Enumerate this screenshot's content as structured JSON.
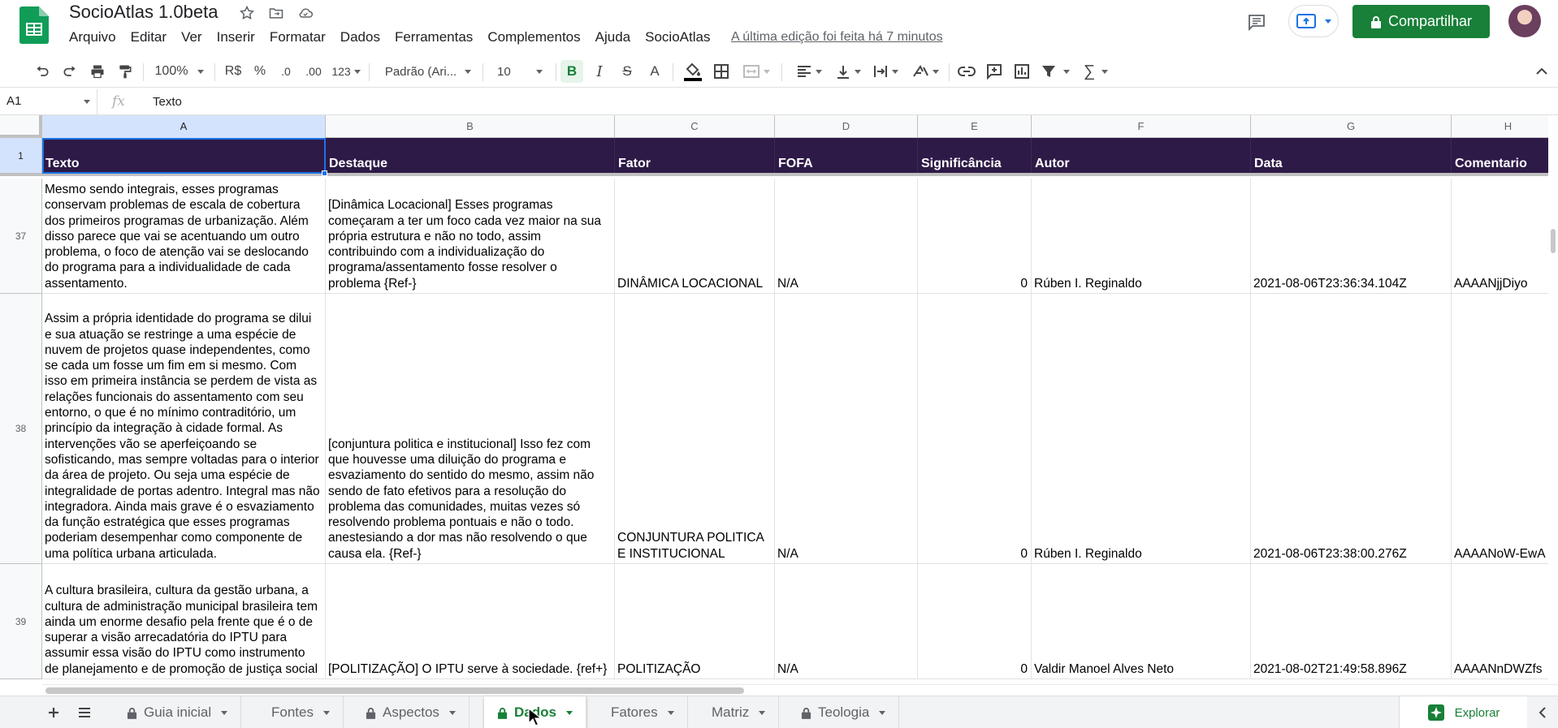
{
  "header": {
    "title": "SocioAtlas 1.0beta",
    "menu": [
      "Arquivo",
      "Editar",
      "Ver",
      "Inserir",
      "Formatar",
      "Dados",
      "Ferramentas",
      "Complementos",
      "Ajuda",
      "SocioAtlas"
    ],
    "last_edit": "A última edição foi feita há 7 minutos",
    "share_label": "Compartilhar",
    "brand_color": "#188038"
  },
  "toolbar": {
    "zoom": "100%",
    "currency": "R$",
    "percent": "%",
    "dec_decrease": ".0",
    "dec_increase": ".00",
    "more_formats": "123",
    "font": "Padrão (Ari...",
    "font_size": "10",
    "bold": "B",
    "italic": "I",
    "strike": "S",
    "text_color": "A"
  },
  "formula_bar": {
    "cell_ref": "A1",
    "fx": "fx",
    "value": "Texto"
  },
  "grid": {
    "columns": [
      "A",
      "B",
      "C",
      "D",
      "E",
      "F",
      "G",
      "H"
    ],
    "header_row_number": "1",
    "header_color": "#2e1a47",
    "headers": [
      "Texto",
      "Destaque",
      "Fator",
      "FOFA",
      "Significância",
      "Autor",
      "Data",
      "Comentario"
    ],
    "rows": [
      {
        "num": "37",
        "cells": [
          "Mesmo sendo integrais, esses programas conservam problemas de escala de cobertura dos primeiros programas de urbanização. Além disso parece que vai se acentuando um outro problema, o foco de atenção vai se deslocando do programa para a individualidade de cada assentamento.",
          "[Dinâmica Locacional] Esses programas começaram a ter um foco cada vez maior na sua própria estrutura e não no todo, assim contribuindo com a individualização do programa/assentamento fosse resolver o problema {Ref-}",
          "DINÂMICA LOCACIONAL",
          "N/A",
          "0",
          "Rúben I. Reginaldo",
          "2021-08-06T23:36:34.104Z",
          "AAAANjjDiyo"
        ]
      },
      {
        "num": "38",
        "cells": [
          "Assim a própria identidade do programa se dilui e sua atuação se restringe a uma espécie de nuvem de projetos quase independentes, como se cada um fosse um fim em si mesmo. Com isso em primeira instância se perdem de vista as relações funcionais do assentamento com seu entorno, o que é no mínimo contraditório, um princípio da integração à cidade formal. As intervenções vão se aperfeiçoando se sofisticando, mas sempre voltadas para o interior da área de projeto. Ou seja uma espécie de integralidade de portas adentro. Integral mas não integradora. Ainda mais grave é o esvaziamento da função estratégica que esses programas poderiam desempenhar como componente de uma política urbana articulada.",
          "[conjuntura politica e institucional] Isso fez com que houvesse uma diluição do programa e esvaziamento do sentido do mesmo, assim não sendo de fato efetivos para a resolução do problema das comunidades, muitas vezes só resolvendo problema pontuais e não o todo. anestesiando a dor mas não resolvendo o que causa ela. {Ref-}",
          "CONJUNTURA POLITICA E INSTITUCIONAL",
          "N/A",
          "0",
          "Rúben I. Reginaldo",
          "2021-08-06T23:38:00.276Z",
          "AAAANoW-EwA"
        ]
      },
      {
        "num": "39",
        "cells": [
          "A cultura brasileira, cultura da gestão urbana, a cultura de administração municipal brasileira tem ainda um enorme desafio pela frente que é o de superar a visão arrecadatória do IPTU para assumir essa visão do IPTU como instrumento de planejamento e de promoção de justiça social",
          "[POLITIZAÇÃO] O IPTU serve à sociedade. {ref+}",
          "POLITIZAÇÃO",
          "N/A",
          "0",
          "Valdir Manoel Alves Neto",
          "2021-08-02T21:49:58.896Z",
          "AAAANnDWZfs"
        ]
      }
    ]
  },
  "sheets": {
    "tabs": [
      {
        "label": "Guia inicial",
        "locked": true
      },
      {
        "label": "Fontes",
        "locked": false
      },
      {
        "label": "Aspectos",
        "locked": true
      },
      {
        "label": "Dados",
        "locked": true,
        "active": true
      },
      {
        "label": "Fatores",
        "locked": false
      },
      {
        "label": "Matriz",
        "locked": false
      },
      {
        "label": "Teologia",
        "locked": true
      }
    ],
    "explore_label": "Explorar"
  }
}
